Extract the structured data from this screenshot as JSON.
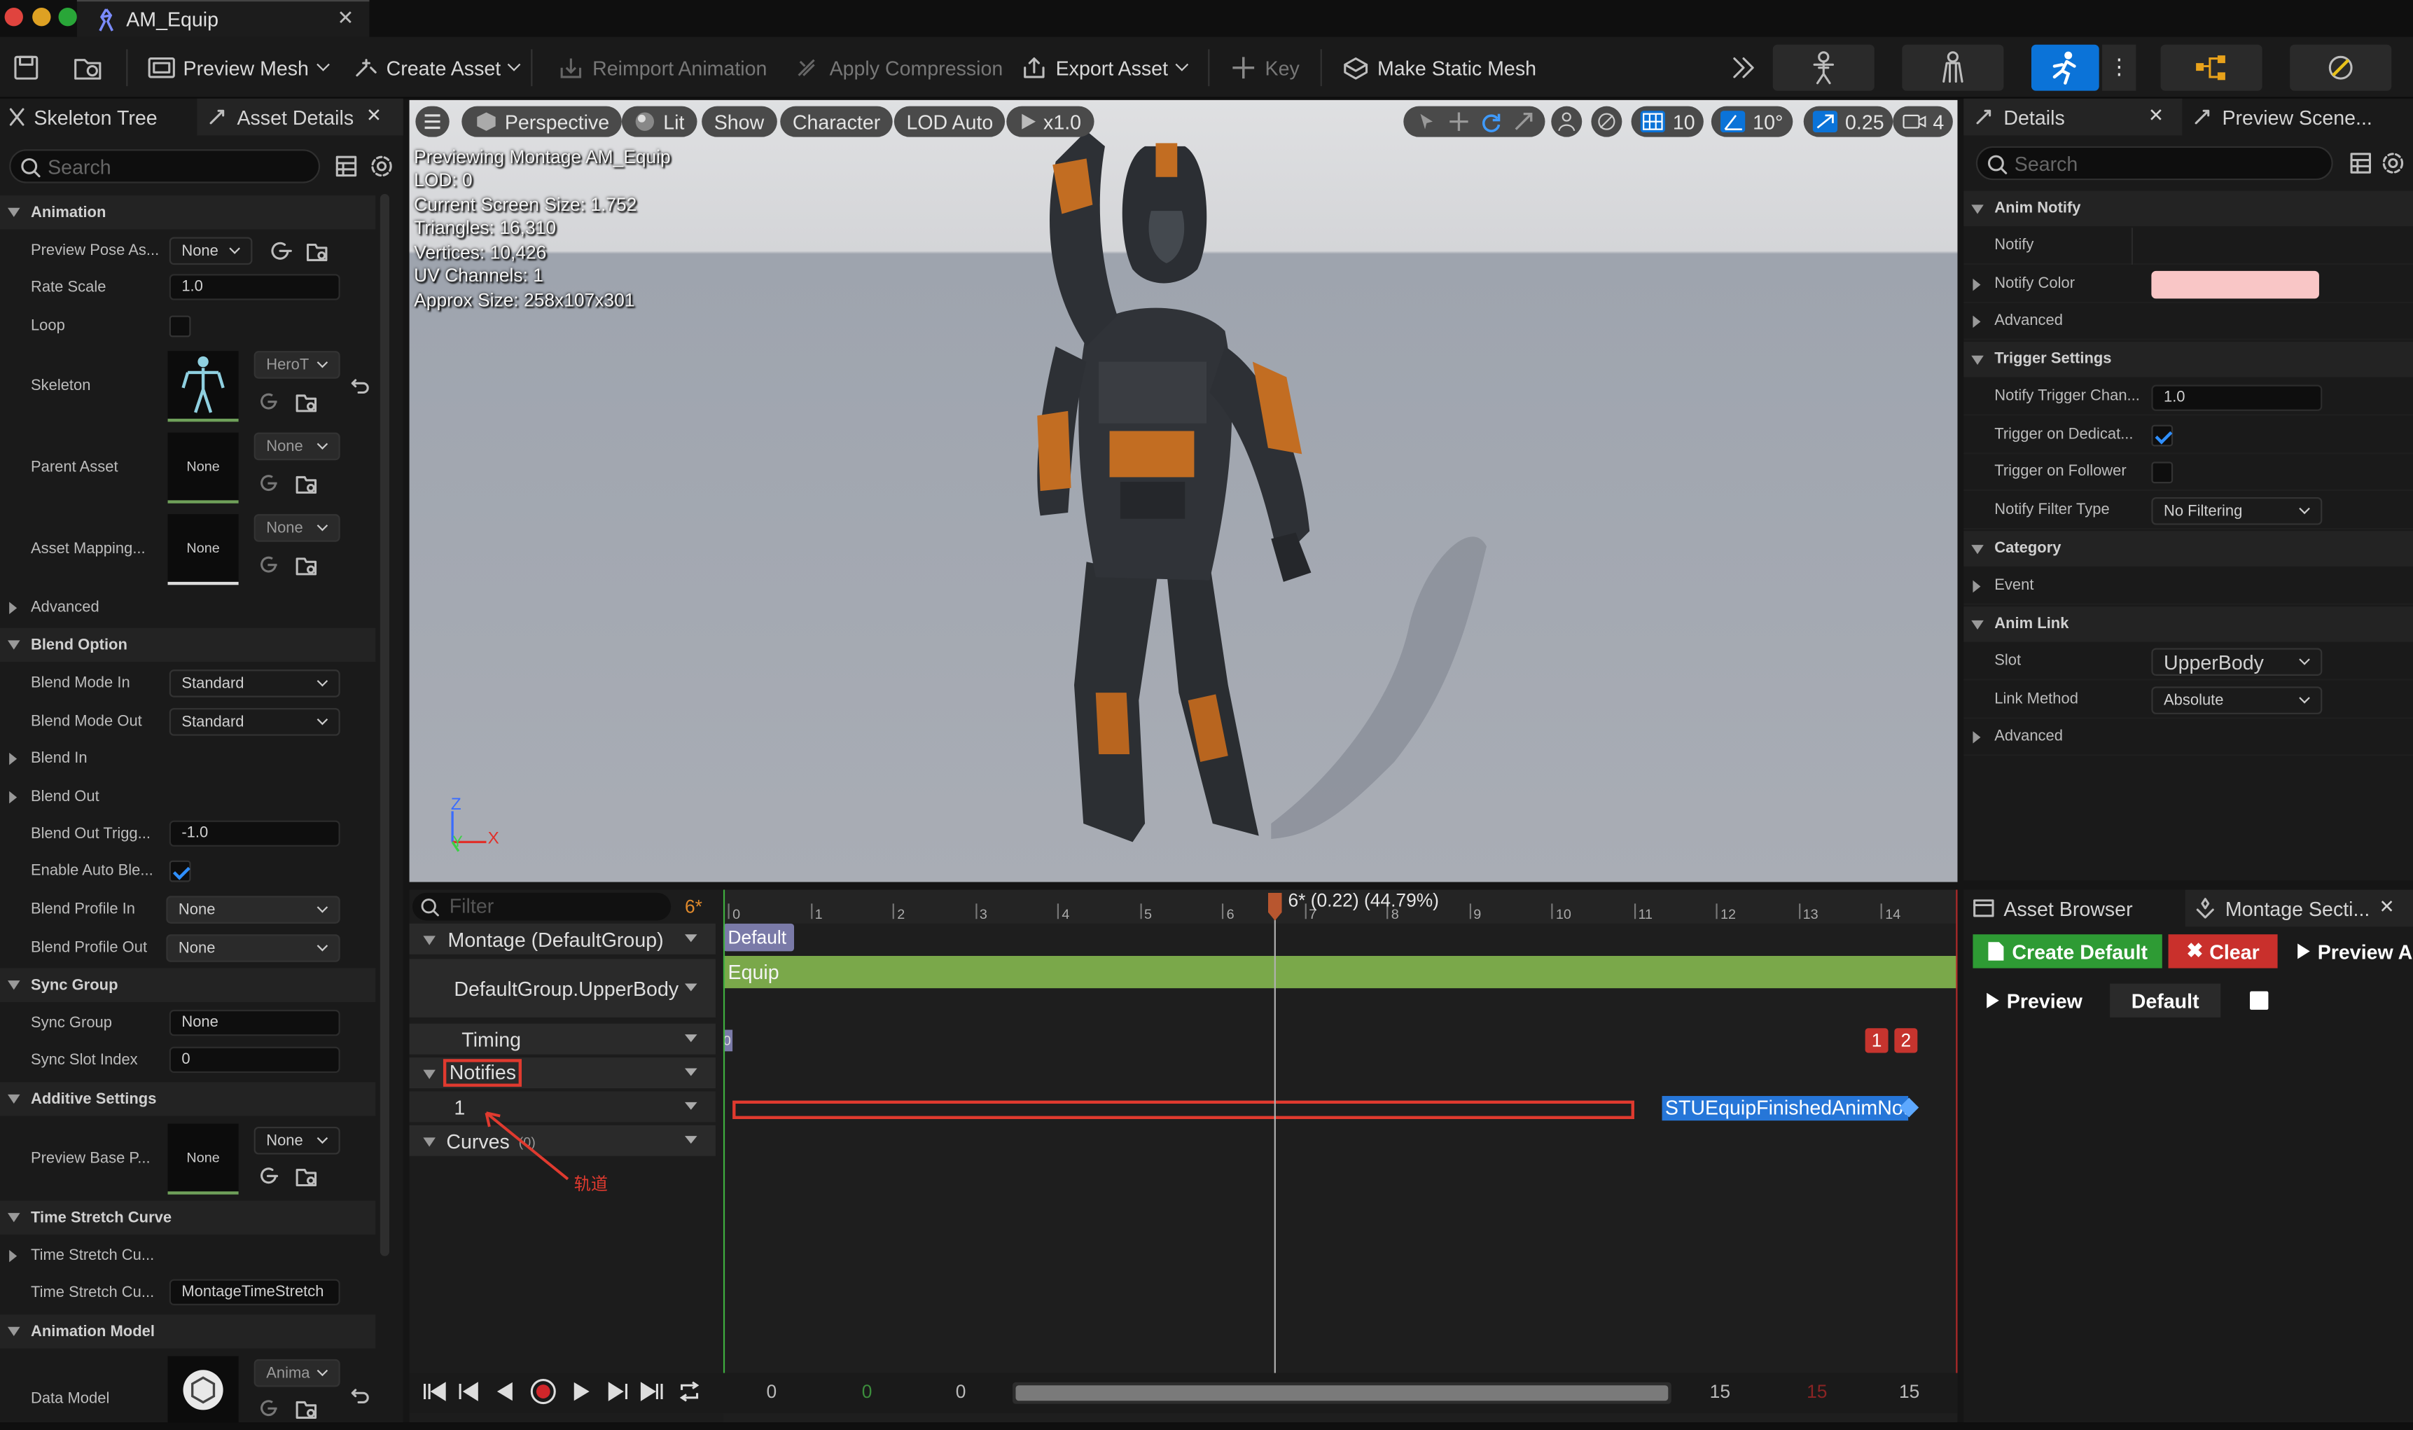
{
  "window": {
    "tab_title": "AM_Equip"
  },
  "toolbar": {
    "preview_mesh": "Preview Mesh",
    "create_asset": "Create Asset",
    "reimport_animation": "Reimport Animation",
    "apply_compression": "Apply Compression",
    "export_asset": "Export Asset",
    "key": "Key",
    "make_static_mesh": "Make Static Mesh"
  },
  "left_panel": {
    "tabs": [
      "Skeleton Tree",
      "Asset Details"
    ],
    "search_placeholder": "Search",
    "categories": {
      "animation": "Animation",
      "blend_option": "Blend Option",
      "sync_group": "Sync Group",
      "additive_settings": "Additive Settings",
      "time_stretch_curve": "Time Stretch Curve",
      "animation_model": "Animation Model"
    },
    "rows": {
      "preview_pose": {
        "label": "Preview Pose As...",
        "value": "None"
      },
      "rate_scale": {
        "label": "Rate Scale",
        "value": "1.0"
      },
      "loop": {
        "label": "Loop"
      },
      "skeleton": {
        "label": "Skeleton",
        "value": "HeroT"
      },
      "parent_asset": {
        "label": "Parent Asset",
        "thumb": "None",
        "value": "None"
      },
      "asset_mapping": {
        "label": "Asset Mapping...",
        "thumb": "None",
        "value": "None"
      },
      "advanced": {
        "label": "Advanced"
      },
      "blend_mode_in": {
        "label": "Blend Mode In",
        "value": "Standard"
      },
      "blend_mode_out": {
        "label": "Blend Mode Out",
        "value": "Standard"
      },
      "blend_in": {
        "label": "Blend In"
      },
      "blend_out": {
        "label": "Blend Out"
      },
      "blend_out_trigger": {
        "label": "Blend Out Trigg...",
        "value": "-1.0"
      },
      "enable_auto_blend": {
        "label": "Enable Auto Ble..."
      },
      "blend_profile_in": {
        "label": "Blend Profile In",
        "value": "None"
      },
      "blend_profile_out": {
        "label": "Blend Profile Out",
        "value": "None"
      },
      "sync_group": {
        "label": "Sync Group",
        "value": "None"
      },
      "sync_slot_index": {
        "label": "Sync Slot Index",
        "value": "0"
      },
      "preview_base": {
        "label": "Preview Base P...",
        "thumb": "None",
        "value": "None"
      },
      "time_stretch_1": {
        "label": "Time Stretch Cu..."
      },
      "time_stretch_2": {
        "label": "Time Stretch Cu...",
        "value": "MontageTimeStretch"
      },
      "data_model": {
        "label": "Data Model",
        "value": "Anima"
      }
    }
  },
  "viewport": {
    "buttons": {
      "perspective": "Perspective",
      "lit": "Lit",
      "show": "Show",
      "character": "Character",
      "lod": "LOD Auto",
      "speed": "x1.0"
    },
    "right_buttons": {
      "grid": "10",
      "angle": "10°",
      "scale": "0.25",
      "camera": "4"
    },
    "stats": [
      "Previewing Montage AM_Equip",
      "LOD: 0",
      "Current Screen Size: 1.752",
      "Triangles: 16,310",
      "Vertices: 10,426",
      "UV Channels: 1",
      "Approx Size: 258x107x301"
    ],
    "axis": {
      "z": "Z",
      "y": "Y",
      "x": "X"
    }
  },
  "timeline": {
    "filter_placeholder": "Filter",
    "current_frame": "6*",
    "tracks": {
      "montage": "Montage (DefaultGroup)",
      "slot": "DefaultGroup.UpperBody",
      "timing": "Timing",
      "notifies": "Notifies",
      "notify_track": "1",
      "curves": "Curves",
      "curves_count": "(0)"
    },
    "section": "Default",
    "segment": "Equip",
    "ticks": [
      "0",
      "1",
      "2",
      "3",
      "4",
      "5",
      "6",
      "7",
      "8",
      "9",
      "10",
      "11",
      "12",
      "13",
      "14"
    ],
    "playhead_label": "6* (0.22) (44.79%)",
    "timing_markers": [
      "1",
      "2"
    ],
    "timing_left": "0",
    "notify_name": "STUEquipFinishedAnimNotify",
    "annotation": "轨道",
    "footer": {
      "start": "0",
      "green": "0",
      "current": "0",
      "end": "15",
      "red": "15",
      "total": "15"
    }
  },
  "right_panel": {
    "tabs": [
      "Details",
      "Preview Scene..."
    ],
    "search_placeholder": "Search",
    "categories": {
      "anim_notify": "Anim Notify",
      "trigger_settings": "Trigger Settings",
      "category": "Category",
      "anim_link": "Anim Link"
    },
    "rows": {
      "notify": "Notify",
      "notify_color": "Notify Color",
      "advanced": "Advanced",
      "notify_trigger_chance": {
        "label": "Notify Trigger Chan...",
        "value": "1.0"
      },
      "trigger_dedicated": "Trigger on Dedicat...",
      "trigger_follower": "Trigger on Follower",
      "notify_filter_type": {
        "label": "Notify Filter Type",
        "value": "No Filtering"
      },
      "event": "Event",
      "slot": {
        "label": "Slot",
        "value": "UpperBody"
      },
      "link_method": {
        "label": "Link Method",
        "value": "Absolute"
      },
      "advanced2": "Advanced"
    },
    "colors": {
      "notify_color": "#f9c6c6"
    }
  },
  "montage_sections": {
    "tabs": [
      "Asset Browser",
      "Montage Secti..."
    ],
    "create_default": "Create Default",
    "clear": "Clear",
    "preview_all": "Preview A",
    "preview": "Preview",
    "default": "Default"
  }
}
